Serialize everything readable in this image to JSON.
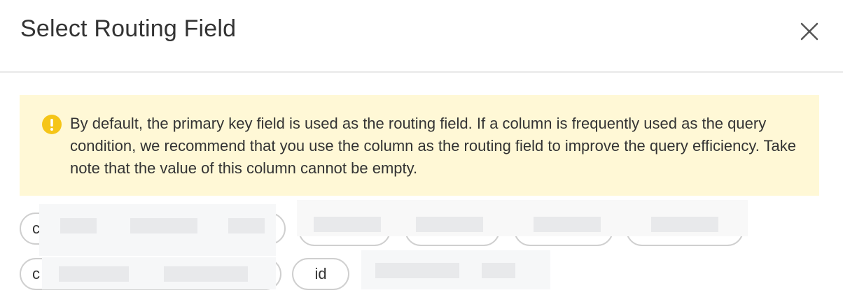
{
  "dialog": {
    "title": "Select Routing Field",
    "close_icon": "close-icon"
  },
  "notice": {
    "icon": "warning-icon",
    "icon_color": "#f5c518",
    "text": "By default, the primary key field is used as the routing field. If a column is frequently used as the query condition, we recommend that you use the column as the routing field to improve the query efficiency. Take note that the value of this column cannot be empty."
  },
  "fields": {
    "row1": [
      "c",
      "",
      "",
      "",
      ""
    ],
    "row2": [
      "c",
      "id",
      ""
    ]
  }
}
